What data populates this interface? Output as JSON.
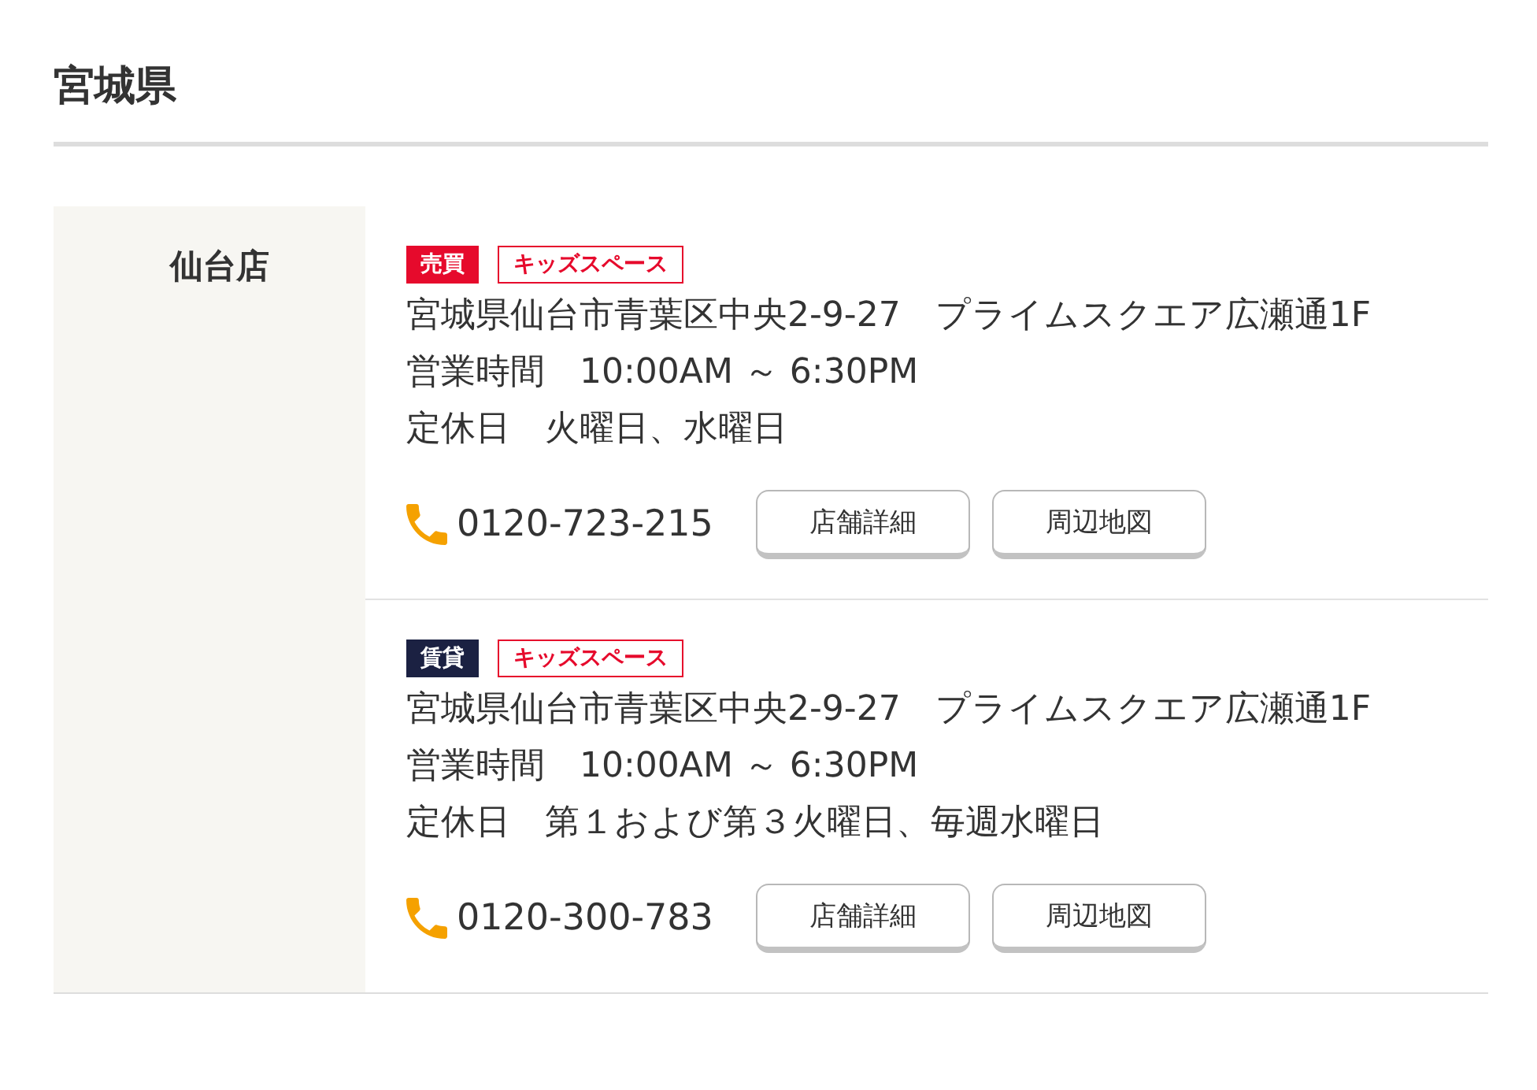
{
  "heading": "宮城県",
  "stores": [
    {
      "name": "仙台店",
      "branches": [
        {
          "tags": [
            {
              "label": "売買",
              "kind": "filled",
              "color": "#e60a2c"
            },
            {
              "label": "キッズスペース",
              "kind": "outline",
              "color": "#e60a2c"
            }
          ],
          "address": "宮城県仙台市青葉区中央2-9-27　プライムスクエア広瀬通1F",
          "hours": "営業時間　10:00AM ～ 6:30PM",
          "holiday": "定休日　火曜日、水曜日",
          "phone": "0120-723-215",
          "buttons": [
            "店舗詳細",
            "周辺地図"
          ]
        },
        {
          "tags": [
            {
              "label": "賃貸",
              "kind": "filled",
              "color": "#1b2142"
            },
            {
              "label": "キッズスペース",
              "kind": "outline",
              "color": "#e60a2c"
            }
          ],
          "address": "宮城県仙台市青葉区中央2-9-27　プライムスクエア広瀬通1F",
          "hours": "営業時間　10:00AM ～ 6:30PM",
          "holiday": "定休日　第１および第３火曜日、毎週水曜日",
          "phone": "0120-300-783",
          "buttons": [
            "店舗詳細",
            "周辺地図"
          ]
        }
      ]
    }
  ]
}
